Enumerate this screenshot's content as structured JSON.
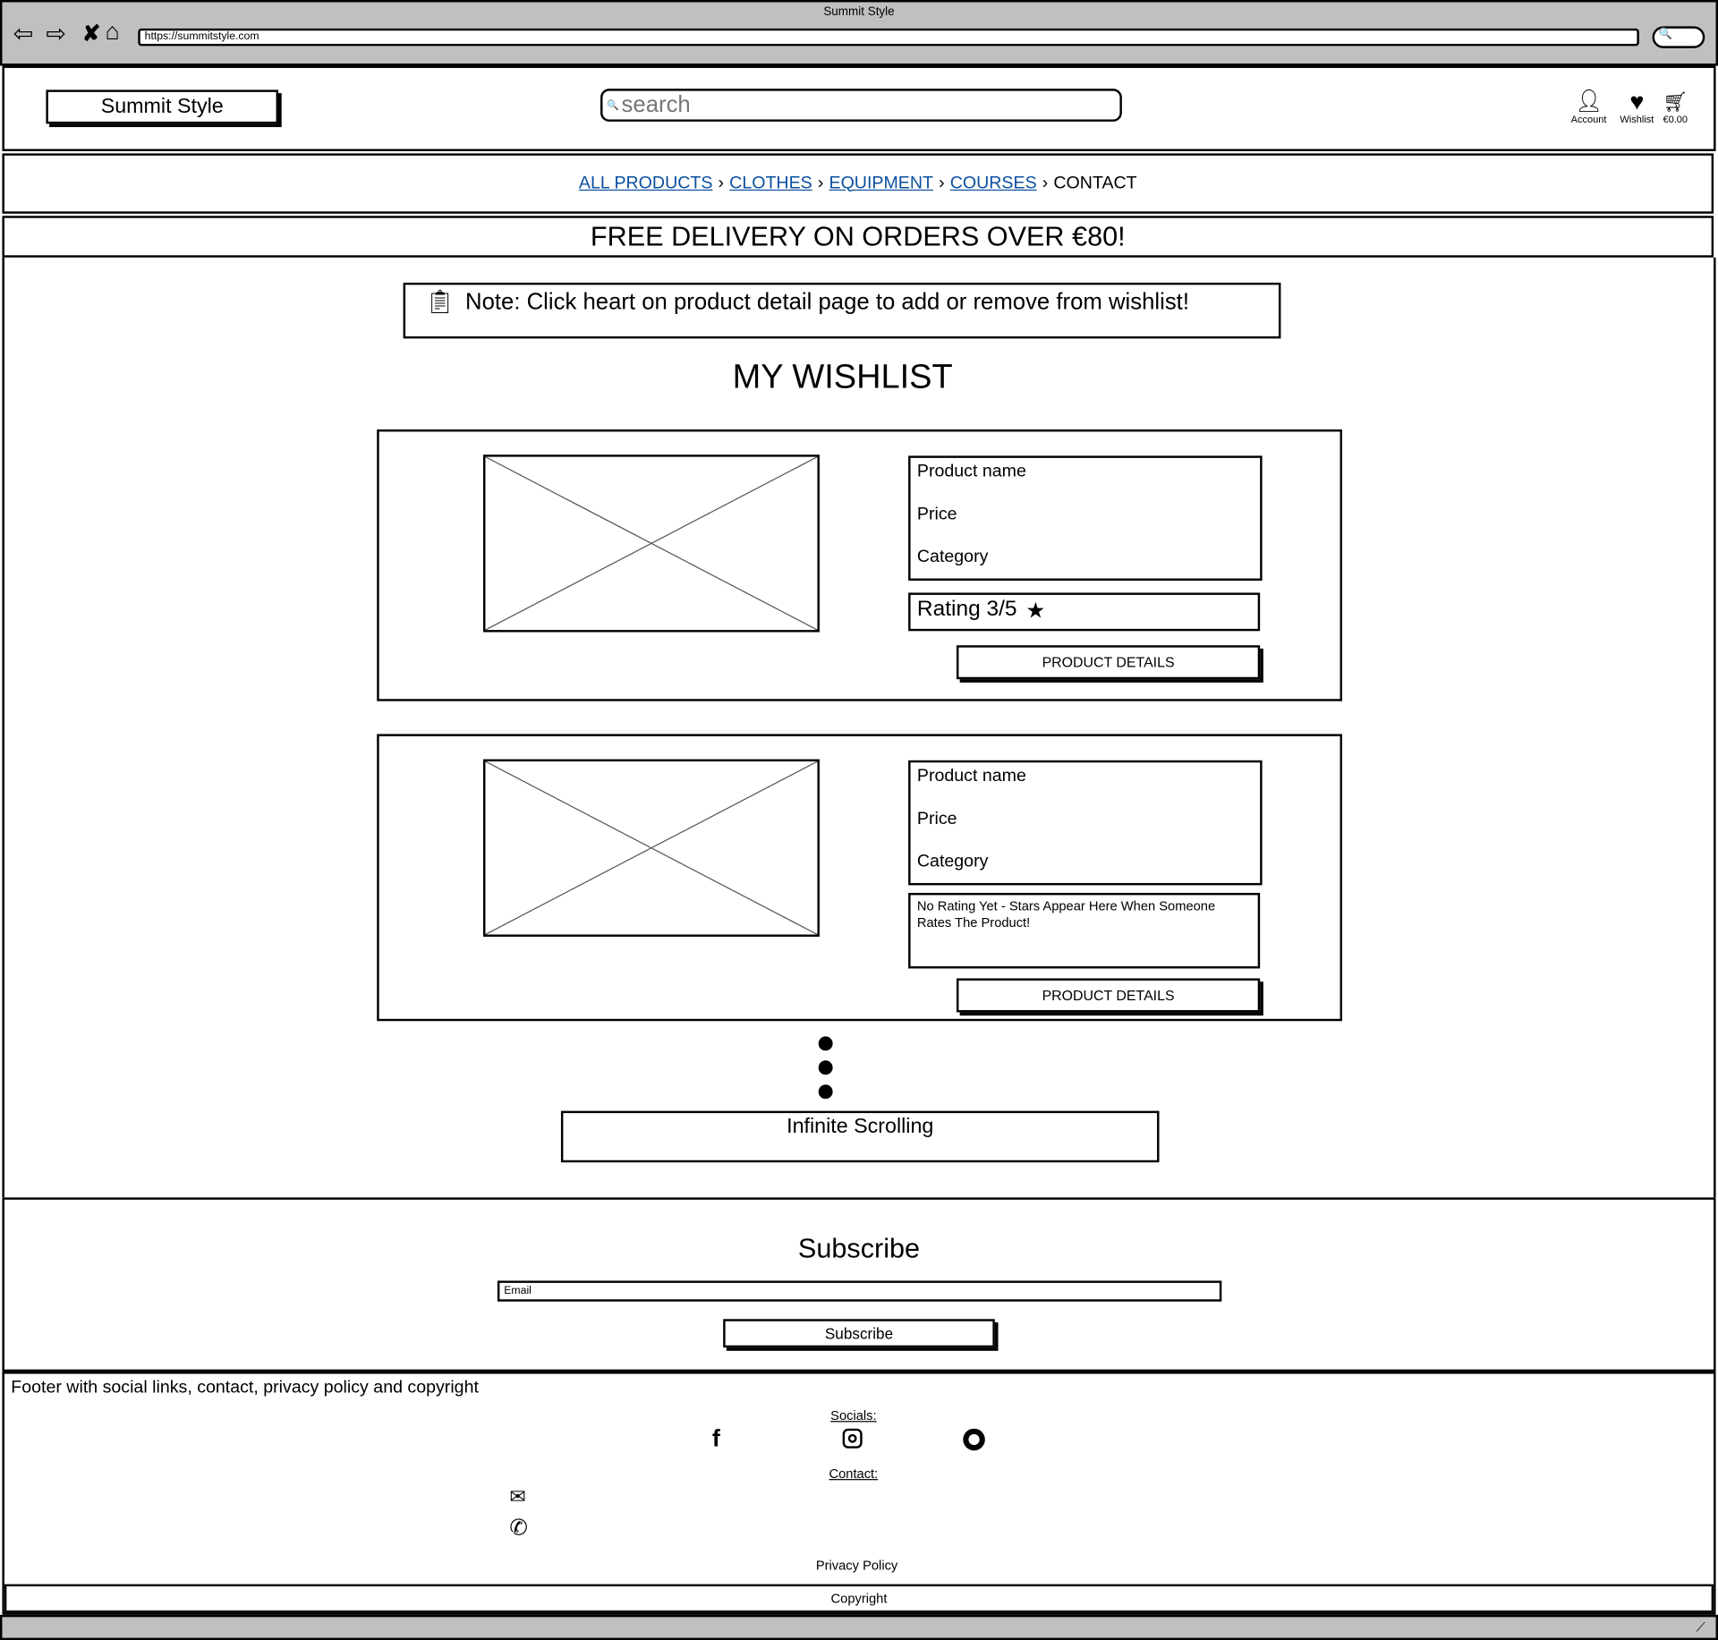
{
  "browser": {
    "title": "Summit Style",
    "url": "https://summitstyle.com"
  },
  "header": {
    "logo": "Summit Style",
    "search_placeholder": "search",
    "account_label": "Account",
    "wishlist_label": "Wishlist",
    "cart_total": "€0.00"
  },
  "breadcrumb": {
    "items": [
      {
        "label": "ALL PRODUCTS",
        "link": true
      },
      {
        "label": "CLOTHES",
        "link": true
      },
      {
        "label": "EQUIPMENT",
        "link": true
      },
      {
        "label": "COURSES",
        "link": true
      },
      {
        "label": "CONTACT",
        "link": false
      }
    ],
    "separator": "›"
  },
  "banner": "FREE DELIVERY ON ORDERS OVER €80!",
  "note": "Note: Click heart on product detail page to add or remove from wishlist!",
  "page_title": "MY WISHLIST",
  "products": [
    {
      "name": "Product name",
      "price": "Price",
      "category": "Category",
      "rating": "Rating 3/5",
      "rating_value": 3,
      "button": "PRODUCT DETAILS"
    },
    {
      "name": "Product name",
      "price": "Price",
      "category": "Category",
      "rating": "No Rating Yet - Stars Appear Here When Someone Rates The Product!",
      "button": "PRODUCT DETAILS"
    }
  ],
  "infinite_scrolling": "Infinite Scrolling",
  "subscribe": {
    "title": "Subscribe",
    "email_placeholder": "Email",
    "button": "Subscribe"
  },
  "footer": {
    "description": "Footer with social links, contact, privacy policy and copyright",
    "socials_label": "Socials:",
    "contact_label": "Contact:",
    "privacy": "Privacy Policy",
    "copyright": "Copyright"
  }
}
